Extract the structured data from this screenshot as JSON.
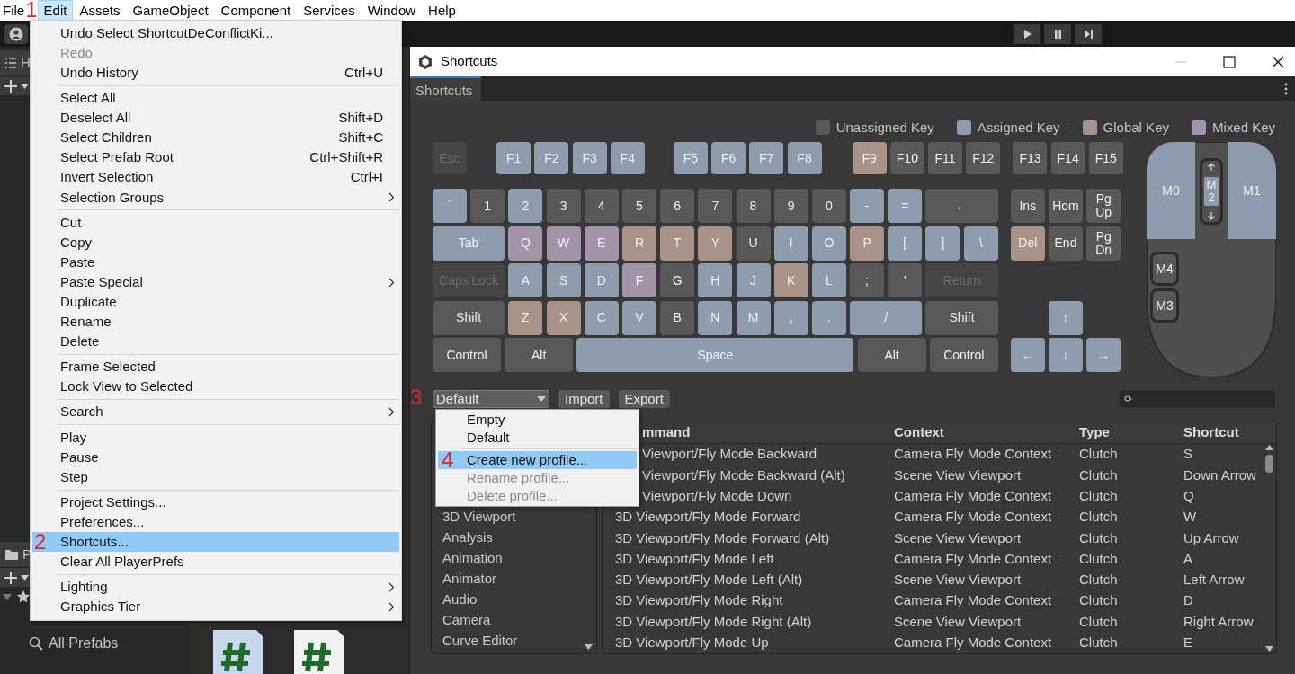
{
  "menubar": {
    "annotation": "1",
    "items": [
      {
        "label": "File",
        "selected": false
      },
      {
        "label": "Edit",
        "selected": true
      },
      {
        "label": "Assets",
        "selected": false
      },
      {
        "label": "GameObject",
        "selected": false
      },
      {
        "label": "Component",
        "selected": false
      },
      {
        "label": "Services",
        "selected": false
      },
      {
        "label": "Window",
        "selected": false
      },
      {
        "label": "Help",
        "selected": false
      }
    ]
  },
  "editor": {
    "hierarchy_tab": "H",
    "project_tab": "P",
    "favorites": [
      "All Prefabs"
    ],
    "assets": [
      {
        "selected": true
      },
      {
        "selected": false
      }
    ]
  },
  "edit_menu": {
    "items": [
      {
        "kind": "item",
        "label": "Undo Select ShortcutDeConflictKi...",
        "disabled": false,
        "selected": false,
        "submenu": false
      },
      {
        "kind": "item",
        "label": "Redo",
        "disabled": true,
        "selected": false,
        "submenu": false
      },
      {
        "kind": "item",
        "label": "Undo History",
        "shortcut": "Ctrl+U",
        "disabled": false,
        "selected": false,
        "submenu": false
      },
      {
        "kind": "separator"
      },
      {
        "kind": "item",
        "label": "Select All",
        "disabled": false,
        "selected": false,
        "submenu": false
      },
      {
        "kind": "item",
        "label": "Deselect All",
        "shortcut": "Shift+D",
        "disabled": false,
        "selected": false,
        "submenu": false
      },
      {
        "kind": "item",
        "label": "Select Children",
        "shortcut": "Shift+C",
        "disabled": false,
        "selected": false,
        "submenu": false
      },
      {
        "kind": "item",
        "label": "Select Prefab Root",
        "shortcut": "Ctrl+Shift+R",
        "disabled": false,
        "selected": false,
        "submenu": false
      },
      {
        "kind": "item",
        "label": "Invert Selection",
        "shortcut": "Ctrl+I",
        "disabled": false,
        "selected": false,
        "submenu": false
      },
      {
        "kind": "item",
        "label": "Selection Groups",
        "disabled": false,
        "selected": false,
        "submenu": true
      },
      {
        "kind": "separator"
      },
      {
        "kind": "item",
        "label": "Cut",
        "disabled": false,
        "selected": false,
        "submenu": false
      },
      {
        "kind": "item",
        "label": "Copy",
        "disabled": false,
        "selected": false,
        "submenu": false
      },
      {
        "kind": "item",
        "label": "Paste",
        "disabled": false,
        "selected": false,
        "submenu": false
      },
      {
        "kind": "item",
        "label": "Paste Special",
        "disabled": false,
        "selected": false,
        "submenu": true
      },
      {
        "kind": "item",
        "label": "Duplicate",
        "disabled": false,
        "selected": false,
        "submenu": false
      },
      {
        "kind": "item",
        "label": "Rename",
        "disabled": false,
        "selected": false,
        "submenu": false
      },
      {
        "kind": "item",
        "label": "Delete",
        "disabled": false,
        "selected": false,
        "submenu": false
      },
      {
        "kind": "separator"
      },
      {
        "kind": "item",
        "label": "Frame Selected",
        "disabled": false,
        "selected": false,
        "submenu": false
      },
      {
        "kind": "item",
        "label": "Lock View to Selected",
        "disabled": false,
        "selected": false,
        "submenu": false
      },
      {
        "kind": "separator"
      },
      {
        "kind": "item",
        "label": "Search",
        "disabled": false,
        "selected": false,
        "submenu": true
      },
      {
        "kind": "separator"
      },
      {
        "kind": "item",
        "label": "Play",
        "disabled": false,
        "selected": false,
        "submenu": false
      },
      {
        "kind": "item",
        "label": "Pause",
        "disabled": false,
        "selected": false,
        "submenu": false
      },
      {
        "kind": "item",
        "label": "Step",
        "disabled": false,
        "selected": false,
        "submenu": false
      },
      {
        "kind": "separator"
      },
      {
        "kind": "item",
        "label": "Project Settings...",
        "disabled": false,
        "selected": false,
        "submenu": false
      },
      {
        "kind": "item",
        "label": "Preferences...",
        "disabled": false,
        "selected": false,
        "submenu": false
      },
      {
        "kind": "item",
        "label": "Shortcuts...",
        "annotation": "2",
        "disabled": false,
        "selected": true,
        "submenu": false
      },
      {
        "kind": "item",
        "label": "Clear All PlayerPrefs",
        "disabled": false,
        "selected": false,
        "submenu": false
      },
      {
        "kind": "separator"
      },
      {
        "kind": "item",
        "label": "Lighting",
        "disabled": false,
        "selected": false,
        "submenu": true
      },
      {
        "kind": "item",
        "label": "Graphics Tier",
        "disabled": false,
        "selected": false,
        "submenu": true
      }
    ]
  },
  "shortcuts_window": {
    "title": "Shortcuts",
    "tab": {
      "label": "Shortcuts",
      "selected": true
    },
    "legend": [
      {
        "label": "Unassigned Key",
        "kind": "unassigned",
        "color": "#585858"
      },
      {
        "label": "Assigned Key",
        "kind": "assigned",
        "color": "#8e9cae"
      },
      {
        "label": "Global Key",
        "kind": "global",
        "color": "#a99388"
      },
      {
        "label": "Mixed Key",
        "kind": "mixed",
        "color": "#a395a8"
      }
    ],
    "keyboard": [
      [
        {
          "label": "Esc",
          "kind": "disabled"
        },
        {
          "label": "F1",
          "kind": "assigned"
        },
        {
          "label": "F2",
          "kind": "assigned"
        },
        {
          "label": "F3",
          "kind": "assigned"
        },
        {
          "label": "F4",
          "kind": "assigned"
        },
        {
          "label": "F5",
          "kind": "assigned"
        },
        {
          "label": "F6",
          "kind": "assigned"
        },
        {
          "label": "F7",
          "kind": "assigned"
        },
        {
          "label": "F8",
          "kind": "assigned"
        },
        {
          "label": "F9",
          "kind": "global"
        },
        {
          "label": "F10",
          "kind": "unassigned"
        },
        {
          "label": "F11",
          "kind": "unassigned"
        },
        {
          "label": "F12",
          "kind": "unassigned"
        },
        {
          "label": "F13",
          "kind": "unassigned"
        },
        {
          "label": "F14",
          "kind": "unassigned"
        },
        {
          "label": "F15",
          "kind": "unassigned"
        }
      ],
      [
        {
          "label": "`",
          "kind": "assigned"
        },
        {
          "label": "1",
          "kind": "unassigned"
        },
        {
          "label": "2",
          "kind": "assigned"
        },
        {
          "label": "3",
          "kind": "unassigned"
        },
        {
          "label": "4",
          "kind": "unassigned"
        },
        {
          "label": "5",
          "kind": "unassigned"
        },
        {
          "label": "6",
          "kind": "unassigned"
        },
        {
          "label": "7",
          "kind": "unassigned"
        },
        {
          "label": "8",
          "kind": "unassigned"
        },
        {
          "label": "9",
          "kind": "unassigned"
        },
        {
          "label": "0",
          "kind": "unassigned"
        },
        {
          "label": "-",
          "kind": "assigned"
        },
        {
          "label": "=",
          "kind": "assigned"
        },
        {
          "label": "←",
          "kind": "unassigned"
        },
        {
          "label": "Ins",
          "kind": "unassigned"
        },
        {
          "label": "Hom",
          "kind": "unassigned"
        },
        {
          "label": "Pg Up",
          "kind": "unassigned"
        }
      ],
      [
        {
          "label": "Tab",
          "kind": "assigned"
        },
        {
          "label": "Q",
          "kind": "mixed"
        },
        {
          "label": "W",
          "kind": "mixed"
        },
        {
          "label": "E",
          "kind": "mixed"
        },
        {
          "label": "R",
          "kind": "global"
        },
        {
          "label": "T",
          "kind": "global"
        },
        {
          "label": "Y",
          "kind": "global"
        },
        {
          "label": "U",
          "kind": "unassigned"
        },
        {
          "label": "I",
          "kind": "assigned"
        },
        {
          "label": "O",
          "kind": "assigned"
        },
        {
          "label": "P",
          "kind": "global"
        },
        {
          "label": "[",
          "kind": "assigned"
        },
        {
          "label": "]",
          "kind": "assigned"
        },
        {
          "label": "\\",
          "kind": "assigned"
        },
        {
          "label": "Del",
          "kind": "global"
        },
        {
          "label": "End",
          "kind": "unassigned"
        },
        {
          "label": "Pg Dn",
          "kind": "unassigned"
        }
      ],
      [
        {
          "label": "Caps Lock",
          "kind": "disabled"
        },
        {
          "label": "A",
          "kind": "assigned"
        },
        {
          "label": "S",
          "kind": "assigned"
        },
        {
          "label": "D",
          "kind": "assigned"
        },
        {
          "label": "F",
          "kind": "mixed"
        },
        {
          "label": "G",
          "kind": "unassigned"
        },
        {
          "label": "H",
          "kind": "assigned"
        },
        {
          "label": "J",
          "kind": "assigned"
        },
        {
          "label": "K",
          "kind": "global"
        },
        {
          "label": "L",
          "kind": "assigned"
        },
        {
          "label": ";",
          "kind": "unassigned"
        },
        {
          "label": "'",
          "kind": "unassigned"
        },
        {
          "label": "Return",
          "kind": "disabled"
        }
      ],
      [
        {
          "label": "Shift",
          "kind": "unassigned"
        },
        {
          "label": "Z",
          "kind": "global"
        },
        {
          "label": "X",
          "kind": "global"
        },
        {
          "label": "C",
          "kind": "assigned"
        },
        {
          "label": "V",
          "kind": "assigned"
        },
        {
          "label": "B",
          "kind": "unassigned"
        },
        {
          "label": "N",
          "kind": "assigned"
        },
        {
          "label": "M",
          "kind": "assigned"
        },
        {
          "label": ",",
          "kind": "assigned"
        },
        {
          "label": ".",
          "kind": "assigned"
        },
        {
          "label": "/",
          "kind": "assigned"
        },
        {
          "label": "Shift",
          "kind": "unassigned"
        },
        {
          "label": "↑",
          "kind": "assigned"
        }
      ],
      [
        {
          "label": "Control",
          "kind": "unassigned"
        },
        {
          "label": "Alt",
          "kind": "unassigned"
        },
        {
          "label": "Space",
          "kind": "assigned"
        },
        {
          "label": "Alt",
          "kind": "unassigned"
        },
        {
          "label": "Control",
          "kind": "unassigned"
        },
        {
          "label": "←",
          "kind": "assigned"
        },
        {
          "label": "↓",
          "kind": "assigned"
        },
        {
          "label": "→",
          "kind": "assigned"
        }
      ]
    ],
    "mouse": [
      {
        "label": "M0",
        "kind": "assigned"
      },
      {
        "label": "M2",
        "kind": "assigned"
      },
      {
        "label": "M1",
        "kind": "assigned"
      },
      {
        "label": "M4",
        "kind": "unassigned"
      },
      {
        "label": "M3",
        "kind": "unassigned"
      }
    ],
    "profile": {
      "value": "Default",
      "annotation": "3",
      "open": true
    },
    "buttons": [
      "Import",
      "Export"
    ],
    "profile_menu": [
      {
        "kind": "item",
        "label": "Empty",
        "disabled": false,
        "selected": false
      },
      {
        "kind": "item",
        "label": "Default",
        "disabled": false,
        "selected": false
      },
      {
        "kind": "separator"
      },
      {
        "kind": "item",
        "label": "Create new profile...",
        "annotation": "4",
        "disabled": false,
        "selected": true
      },
      {
        "kind": "item",
        "label": "Rename profile...",
        "disabled": true,
        "selected": false
      },
      {
        "kind": "item",
        "label": "Delete profile...",
        "disabled": true,
        "selected": false
      }
    ],
    "categories": [
      "3D Viewport",
      "Analysis",
      "Animation",
      "Animator",
      "Audio",
      "Camera",
      "Curve Editor"
    ],
    "table": {
      "columns": [
        "mmand",
        "Context",
        "Type",
        "Shortcut"
      ],
      "rows": [
        [
          "Viewport/Fly Mode Backward",
          "Camera Fly Mode Context",
          "Clutch",
          "S"
        ],
        [
          "Viewport/Fly Mode Backward (Alt)",
          "Scene View Viewport",
          "Clutch",
          "Down Arrow"
        ],
        [
          "Viewport/Fly Mode Down",
          "Camera Fly Mode Context",
          "Clutch",
          "Q"
        ],
        [
          "3D Viewport/Fly Mode Forward",
          "Camera Fly Mode Context",
          "Clutch",
          "W"
        ],
        [
          "3D Viewport/Fly Mode Forward (Alt)",
          "Scene View Viewport",
          "Clutch",
          "Up Arrow"
        ],
        [
          "3D Viewport/Fly Mode Left",
          "Camera Fly Mode Context",
          "Clutch",
          "A"
        ],
        [
          "3D Viewport/Fly Mode Left (Alt)",
          "Scene View Viewport",
          "Clutch",
          "Left Arrow"
        ],
        [
          "3D Viewport/Fly Mode Right",
          "Camera Fly Mode Context",
          "Clutch",
          "D"
        ],
        [
          "3D Viewport/Fly Mode Right (Alt)",
          "Scene View Viewport",
          "Clutch",
          "Right Arrow"
        ],
        [
          "3D Viewport/Fly Mode Up",
          "Camera Fly Mode Context",
          "Clutch",
          "E"
        ]
      ]
    }
  }
}
